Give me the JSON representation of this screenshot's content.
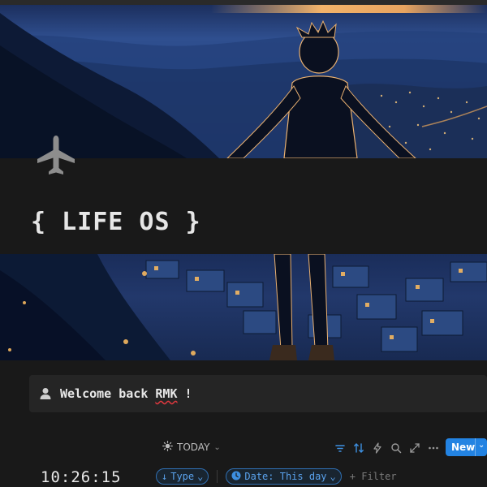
{
  "page": {
    "title": "{ LIFE OS }",
    "icon": "airplane-icon"
  },
  "callout": {
    "icon": "person-icon",
    "text_before": "Welcome back ",
    "text_name": "RMK",
    "text_after": " !"
  },
  "clock": {
    "time": "10:26:15"
  },
  "database": {
    "view_label": "TODAY",
    "view_icon": "sun-icon",
    "toolbar_icons": [
      "filter-icon",
      "sort-icon",
      "automation-bolt-icon",
      "search-icon",
      "expand-icon",
      "more-icon"
    ],
    "new_button_label": "New",
    "filters": [
      {
        "icon": "arrow-down-icon",
        "label": "Type"
      },
      {
        "icon": "clock-icon",
        "label": "Date: This day"
      }
    ],
    "add_filter_label": "+ Filter"
  },
  "colors": {
    "background": "#191919",
    "accent": "#2383e2",
    "filter_text": "#5aa2ec"
  }
}
